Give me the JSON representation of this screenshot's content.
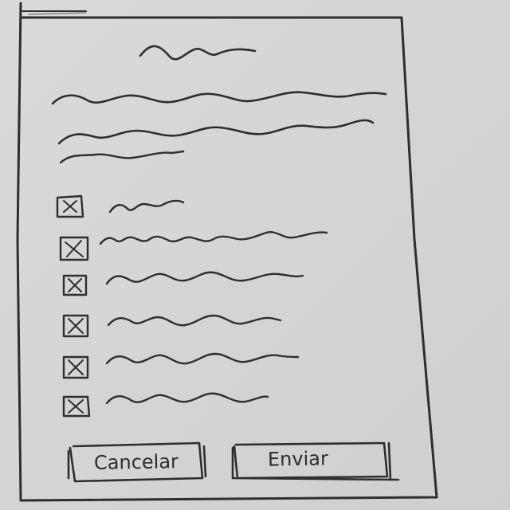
{
  "dialog": {
    "title_placeholder": "scribble-short",
    "description_lines": 3,
    "checkbox_items": [
      {
        "checked": true,
        "text": "scribble"
      },
      {
        "checked": true,
        "text": "scribble"
      },
      {
        "checked": true,
        "text": "scribble"
      },
      {
        "checked": true,
        "text": "scribble"
      },
      {
        "checked": true,
        "text": "scribble"
      },
      {
        "checked": true,
        "text": "scribble"
      }
    ],
    "buttons": {
      "cancel_label": "Cancelar",
      "send_label": "Enviar"
    }
  }
}
